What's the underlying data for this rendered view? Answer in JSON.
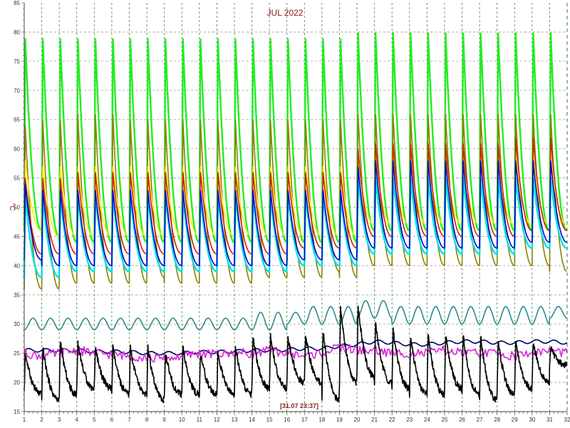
{
  "chart_data": {
    "type": "line",
    "title": "JUL 2022",
    "ylabel": "°C",
    "timestamp": "[31.07 23:37]",
    "xlim": [
      1,
      32
    ],
    "ylim": [
      15,
      85
    ],
    "xticks": [
      "1",
      "2",
      "3",
      "4",
      "5",
      "6",
      "7",
      "8",
      "9",
      "10",
      "11",
      "12",
      "13",
      "14",
      "15",
      "16",
      "17",
      "18",
      "19",
      "20",
      "21",
      "22",
      "23",
      "24",
      "25",
      "26",
      "27",
      "28",
      "29",
      "30",
      "31",
      "32"
    ],
    "yticks": [
      "15",
      "20",
      "25",
      "30",
      "35",
      "40",
      "45",
      "50",
      "55",
      "60",
      "65",
      "70",
      "75",
      "80",
      "85"
    ],
    "grid": true,
    "series": [
      {
        "color": "#22ee22",
        "shape": "daily-cycle",
        "x": [
          1,
          2,
          3,
          4,
          5,
          6,
          7,
          8,
          9,
          10,
          11,
          12,
          13,
          14,
          15,
          16,
          17,
          18,
          19,
          20,
          21,
          22,
          23,
          24,
          25,
          26,
          27,
          28,
          29,
          30,
          31
        ],
        "max": [
          79,
          79,
          79,
          79,
          79,
          79,
          79,
          79,
          79,
          79,
          79,
          79,
          79,
          79,
          79,
          79,
          79,
          79,
          79,
          80,
          80,
          80,
          80,
          80,
          80,
          80,
          80,
          80,
          80,
          80,
          80
        ],
        "min": [
          46,
          45,
          44,
          44,
          44,
          44,
          44,
          44,
          44,
          44,
          44,
          44,
          44,
          44,
          44,
          44,
          44,
          44,
          44,
          46,
          46,
          46,
          46,
          46,
          46,
          46,
          46,
          46,
          46,
          46,
          46
        ]
      },
      {
        "color": "#8b8000",
        "shape": "daily-cycle",
        "x": [
          1,
          2,
          3,
          4,
          5,
          6,
          7,
          8,
          9,
          10,
          11,
          12,
          13,
          14,
          15,
          16,
          17,
          18,
          19,
          20,
          21,
          22,
          23,
          24,
          25,
          26,
          27,
          28,
          29,
          30,
          31
        ],
        "max": [
          64,
          65,
          65,
          66,
          66,
          66,
          65,
          65,
          65,
          65,
          65,
          65,
          65,
          65,
          65,
          65,
          65,
          65,
          65,
          66,
          66,
          66,
          66,
          66,
          66,
          66,
          66,
          66,
          66,
          66,
          66
        ],
        "min": [
          36,
          36,
          37,
          37,
          37,
          37,
          37,
          38,
          37,
          37,
          37,
          37,
          37,
          38,
          38,
          38,
          38,
          39,
          38,
          40,
          40,
          40,
          40,
          40,
          40,
          40,
          40,
          40,
          40,
          40,
          39
        ]
      },
      {
        "color": "#ffee00",
        "shape": "daily-cycle",
        "x": [
          1,
          2,
          3,
          4,
          5,
          6,
          7,
          8,
          9,
          10,
          11,
          12,
          13,
          14,
          15,
          16,
          17,
          18,
          19,
          20,
          21,
          22,
          23,
          24,
          25,
          26,
          27,
          28,
          29,
          30,
          31
        ],
        "max": [
          58,
          57,
          57,
          57,
          57,
          57,
          57,
          57,
          57,
          57,
          57,
          57,
          57,
          57,
          57,
          57,
          57,
          57,
          57,
          59,
          59,
          59,
          59,
          59,
          59,
          59,
          59,
          59,
          59,
          59,
          59
        ],
        "min": [
          46,
          45,
          45,
          45,
          45,
          45,
          45,
          45,
          45,
          45,
          45,
          45,
          45,
          45,
          45,
          45,
          45,
          45,
          45,
          47,
          47,
          47,
          47,
          47,
          47,
          47,
          47,
          47,
          47,
          47,
          47
        ]
      },
      {
        "color": "#cc2200",
        "shape": "daily-cycle",
        "x": [
          1,
          2,
          3,
          4,
          5,
          6,
          7,
          8,
          9,
          10,
          11,
          12,
          13,
          14,
          15,
          16,
          17,
          18,
          19,
          20,
          21,
          22,
          23,
          24,
          25,
          26,
          27,
          28,
          29,
          30,
          31
        ],
        "max": [
          55,
          55,
          55,
          56,
          56,
          56,
          56,
          56,
          56,
          56,
          56,
          56,
          56,
          56,
          56,
          56,
          56,
          56,
          56,
          60,
          61,
          61,
          61,
          61,
          61,
          61,
          61,
          61,
          62,
          62,
          62
        ],
        "min": [
          42,
          42,
          42,
          42,
          42,
          42,
          42,
          42,
          42,
          42,
          42,
          42,
          42,
          42,
          42,
          43,
          43,
          43,
          43,
          45,
          45,
          45,
          45,
          45,
          45,
          45,
          45,
          45,
          46,
          46,
          46
        ]
      },
      {
        "color": "#00e0e0",
        "shape": "daily-cycle",
        "x": [
          1,
          2,
          3,
          4,
          5,
          6,
          7,
          8,
          9,
          10,
          11,
          12,
          13,
          14,
          15,
          16,
          17,
          18,
          19,
          20,
          21,
          22,
          23,
          24,
          25,
          26,
          27,
          28,
          29,
          30,
          31
        ],
        "max": [
          52,
          52,
          52,
          52,
          52,
          52,
          52,
          52,
          52,
          52,
          52,
          52,
          52,
          52,
          52,
          52,
          52,
          52,
          52,
          55,
          55,
          55,
          55,
          55,
          55,
          55,
          55,
          55,
          55,
          55,
          55
        ],
        "min": [
          38,
          38,
          39,
          39,
          39,
          39,
          39,
          39,
          39,
          39,
          39,
          39,
          39,
          39,
          39,
          40,
          40,
          40,
          40,
          42,
          42,
          42,
          42,
          42,
          42,
          42,
          42,
          42,
          43,
          43,
          43
        ]
      },
      {
        "color": "#0000cc",
        "shape": "daily-cycle",
        "x": [
          1,
          2,
          3,
          4,
          5,
          6,
          7,
          8,
          9,
          10,
          11,
          12,
          13,
          14,
          15,
          16,
          17,
          18,
          19,
          20,
          21,
          22,
          23,
          24,
          25,
          26,
          27,
          28,
          29,
          30,
          31
        ],
        "max": [
          54,
          53,
          53,
          53,
          53,
          53,
          53,
          53,
          53,
          53,
          53,
          53,
          53,
          53,
          53,
          53,
          53,
          53,
          53,
          57,
          58,
          58,
          58,
          58,
          58,
          58,
          58,
          58,
          58,
          58,
          58
        ],
        "min": [
          41,
          40,
          40,
          40,
          40,
          40,
          40,
          40,
          40,
          40,
          40,
          40,
          40,
          40,
          40,
          41,
          41,
          41,
          41,
          43,
          43,
          43,
          43,
          43,
          43,
          43,
          43,
          43,
          44,
          44,
          44
        ]
      },
      {
        "color": "#2e8b8b",
        "shape": "wave",
        "x": [
          1,
          2,
          3,
          4,
          5,
          6,
          7,
          8,
          9,
          10,
          11,
          12,
          13,
          14,
          15,
          16,
          17,
          18,
          19,
          20,
          21,
          22,
          23,
          24,
          25,
          26,
          27,
          28,
          29,
          30,
          31
        ],
        "max": [
          31,
          31,
          31,
          31,
          31,
          31,
          31,
          31,
          31,
          31,
          31,
          31,
          31,
          32,
          32,
          32,
          33,
          33,
          33,
          34,
          34,
          33,
          33,
          33,
          33,
          33,
          33,
          33,
          33,
          33,
          33
        ],
        "min": [
          29,
          29,
          29,
          29,
          29,
          29,
          29,
          29,
          29,
          29,
          29,
          29,
          29,
          29,
          29,
          30,
          30,
          30,
          30,
          31,
          31,
          30,
          30,
          30,
          30,
          30,
          30,
          30,
          30,
          30,
          31
        ]
      },
      {
        "color": "#000066",
        "shape": "smooth",
        "x": [
          1,
          2,
          3,
          4,
          5,
          6,
          7,
          8,
          9,
          10,
          11,
          12,
          13,
          14,
          15,
          16,
          17,
          18,
          19,
          20,
          21,
          22,
          23,
          24,
          25,
          26,
          27,
          28,
          29,
          30,
          31,
          32
        ],
        "y": [
          25.5,
          25.5,
          25.5,
          25.5,
          25.3,
          25.3,
          25.2,
          25.0,
          25.0,
          25.0,
          25.2,
          25.2,
          25.3,
          25.5,
          25.5,
          25.6,
          25.8,
          25.8,
          26.2,
          26.5,
          27.0,
          26.8,
          26.5,
          26.5,
          26.8,
          27.0,
          27.0,
          26.8,
          26.8,
          27.0,
          27.0,
          26.8
        ]
      },
      {
        "color": "#dd22dd",
        "shape": "noisy",
        "x": [
          1,
          2,
          3,
          4,
          5,
          6,
          7,
          8,
          9,
          10,
          11,
          12,
          13,
          14,
          15,
          16,
          17,
          18,
          19,
          20,
          21,
          22,
          23,
          24,
          25,
          26,
          27,
          28,
          29,
          30,
          31,
          32
        ],
        "y": [
          25.0,
          24.5,
          25.0,
          25.5,
          25.0,
          24.8,
          24.5,
          24.2,
          24.0,
          24.5,
          25.0,
          24.8,
          25.0,
          25.0,
          25.5,
          25.0,
          24.5,
          25.0,
          26.0,
          25.5,
          25.5,
          25.0,
          25.0,
          25.0,
          25.5,
          25.0,
          25.0,
          25.0,
          24.5,
          25.0,
          25.5,
          25.0
        ]
      },
      {
        "color": "#000000",
        "shape": "daily-cycle",
        "x": [
          1,
          2,
          3,
          4,
          5,
          6,
          7,
          8,
          9,
          10,
          11,
          12,
          13,
          14,
          15,
          16,
          17,
          18,
          19,
          20,
          21,
          22,
          23,
          24,
          25,
          26,
          27,
          28,
          29,
          30,
          31
        ],
        "max": [
          25,
          26,
          27,
          27,
          26,
          26,
          26,
          26,
          25,
          26,
          25,
          25,
          26,
          28,
          28,
          28,
          28,
          29,
          33,
          33,
          30,
          29,
          28,
          28,
          28,
          28,
          28,
          27,
          27,
          27,
          26
        ],
        "min": [
          18,
          17,
          18,
          19,
          19,
          18,
          18,
          17,
          18,
          18,
          18,
          18,
          18,
          19,
          19,
          20,
          20,
          17,
          20,
          21,
          20,
          19,
          18,
          18,
          19,
          18,
          17,
          18,
          19,
          20,
          23
        ]
      }
    ]
  }
}
